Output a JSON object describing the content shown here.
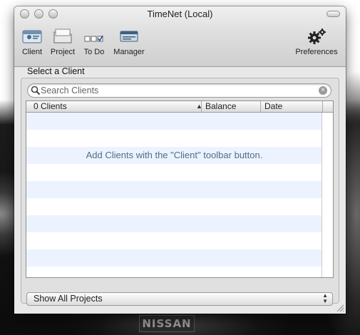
{
  "window": {
    "title": "TimeNet (Local)"
  },
  "toolbar": {
    "items": [
      {
        "label": "Client",
        "icon": "client-icon"
      },
      {
        "label": "Project",
        "icon": "project-icon"
      },
      {
        "label": "To Do",
        "icon": "todo-icon"
      },
      {
        "label": "Manager",
        "icon": "manager-icon"
      },
      {
        "label": "Preferences",
        "icon": "gear-icon"
      }
    ]
  },
  "main": {
    "section_label": "Select a Client",
    "search": {
      "placeholder": "Search Clients",
      "value": ""
    },
    "table": {
      "columns": [
        "0 Clients",
        "Balance",
        "Date"
      ],
      "sorted_column": "0 Clients",
      "sort_direction": "ascending",
      "rows": [],
      "empty_message": "Add Clients with the \"Client\" toolbar button."
    },
    "project_filter": {
      "selected": "Show All Projects"
    }
  },
  "desktop": {
    "badge_text": "NISSAN"
  },
  "colors": {
    "row_alt": "#edf3fe",
    "empty_text": "#4e6f86"
  }
}
